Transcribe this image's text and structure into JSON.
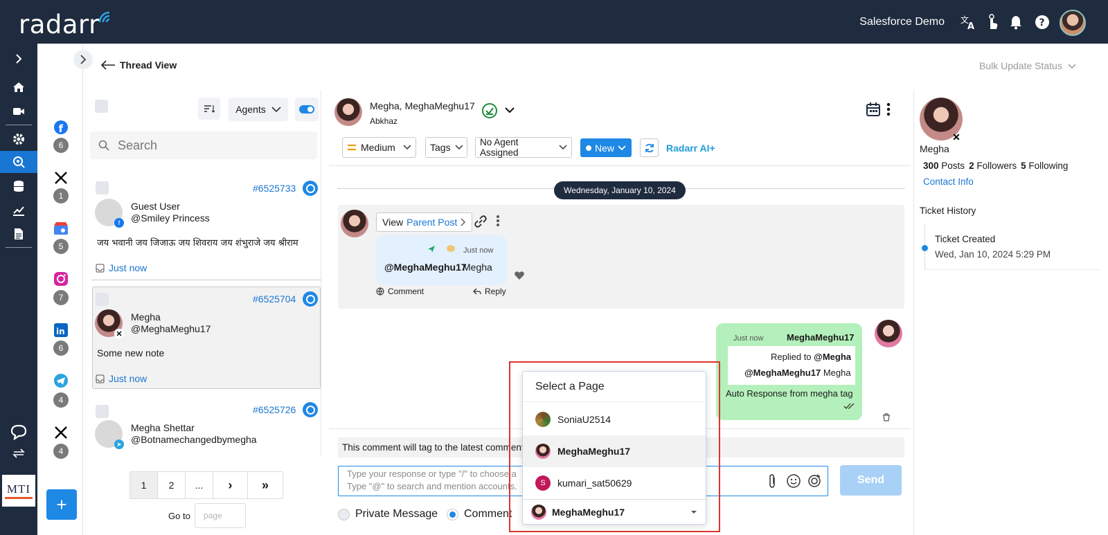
{
  "app": {
    "logo": "radarr",
    "org": "Salesforce Demo",
    "brand_color": "#1f2b3e",
    "accent": "#1976d2"
  },
  "topbar_icons": [
    "translate-icon",
    "tap-hand-icon",
    "bell-icon",
    "help-icon",
    "user-avatar"
  ],
  "nav_icons": [
    "collapse-chevron-icon",
    "home-icon",
    "video-icon",
    "settings-icon",
    "listen-icon",
    "database-icon",
    "analytics-icon",
    "report-icon",
    "chat-bubble-icon",
    "switch-icon"
  ],
  "partner_logo": "MTI",
  "channels": [
    {
      "icon": "facebook-icon",
      "count": "6"
    },
    {
      "icon": "x-icon",
      "count": "1"
    },
    {
      "icon": "google-business-icon",
      "count": "5"
    },
    {
      "icon": "instagram-icon",
      "count": "7"
    },
    {
      "icon": "linkedin-icon",
      "count": "6"
    },
    {
      "icon": "telegram-icon",
      "count": "4"
    },
    {
      "icon": "x-icon",
      "count": "4"
    }
  ],
  "header": {
    "back_label": "Thread View",
    "bulk_label": "Bulk Update Status"
  },
  "list": {
    "agents_label": "Agents",
    "search_placeholder": "Search",
    "tickets": [
      {
        "id": "#6525733",
        "name": "Guest User",
        "handle": "@Smiley Princess",
        "text": "जय भवानी जय जिजाऊ जय शिवराय जय शंभुराजे जय श्रीराम",
        "time": "Just now",
        "channel": "facebook"
      },
      {
        "id": "#6525704",
        "name": "Megha",
        "handle": "@MeghaMeghu17",
        "text": "Some new note",
        "time": "Just now",
        "channel": "x"
      },
      {
        "id": "#6525726",
        "name": "Megha Shettar",
        "handle": "@Botnamechangedbymegha",
        "text": "",
        "time": "",
        "channel": "telegram"
      }
    ],
    "pages": [
      "1",
      "2",
      "...",
      "›",
      "»"
    ],
    "goto_label": "Go to",
    "goto_placeholder": "page"
  },
  "conversation": {
    "title": "Megha, MeghaMeghu17",
    "location": "Abkhaz",
    "priority": "Medium",
    "tags_label": "Tags",
    "agent_label": "No Agent Assigned",
    "status": "New",
    "ai_label": "Radarr AI+",
    "date": "Wednesday, January 10, 2024",
    "view_label": "View",
    "parent_post_label": "Parent Post",
    "msg_time": "Just now",
    "msg_handle": "@MeghaMeghu17",
    "msg_text": "Megha",
    "comment_label": "Comment",
    "reply_label": "Reply",
    "reply_time": "Just now",
    "reply_author": "MeghaMeghu17",
    "replied_to_prefix": "Replied to",
    "replied_to_name": "@Megha",
    "quoted_handle": "@MeghaMeghu17",
    "quoted_text": "Megha",
    "reply_text": "Auto Response from megha tag",
    "notice": "This comment will tag to the latest comment",
    "input_line1": "Type your response or type \"/\" to choose a",
    "input_line2": "Type \"@\" to search and mention accounts.",
    "send_label": "Send",
    "private_label": "Private Message",
    "comment_option": "Comment"
  },
  "dropdown": {
    "title": "Select a Page",
    "items": [
      "SoniaU2514",
      "MeghaMeghu17",
      "kumari_sat50629"
    ],
    "selected": "MeghaMeghu17"
  },
  "profile": {
    "name": "Megha",
    "posts": "300",
    "posts_label": "Posts",
    "followers": "2",
    "followers_label": "Followers",
    "following": "5",
    "following_label": "Following",
    "contact_label": "Contact Info",
    "history_label": "Ticket History",
    "event": "Ticket Created",
    "event_time": "Wed, Jan 10, 2024 5:29 PM"
  }
}
